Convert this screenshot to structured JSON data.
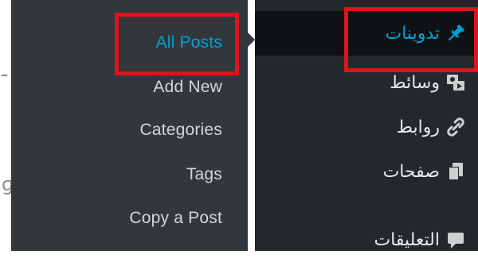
{
  "background_fragments": [
    {
      "text": "ـ"
    },
    {
      "text": "ɡ"
    }
  ],
  "submenu": {
    "items": [
      {
        "label": "All Posts",
        "active": true
      },
      {
        "label": "Add New",
        "active": false
      },
      {
        "label": "Categories",
        "active": false
      },
      {
        "label": "Tags",
        "active": false
      },
      {
        "label": "Copy a Post",
        "active": false
      }
    ]
  },
  "menu": {
    "items": [
      {
        "label": "تدوينات",
        "icon": "pushpin-icon",
        "current": true
      },
      {
        "label": "وسائط",
        "icon": "media-icon",
        "current": false
      },
      {
        "label": "روابط",
        "icon": "link-icon",
        "current": false
      },
      {
        "label": "صفحات",
        "icon": "pages-icon",
        "current": false
      },
      {
        "label": "التعليقات",
        "icon": "comments-icon",
        "current": false
      }
    ]
  },
  "colors": {
    "active_text": "#00a0d2",
    "submenu_bg": "#32373c",
    "menu_bg": "#23282d",
    "current_bg": "#0f1215",
    "highlight": "#e0121b"
  }
}
